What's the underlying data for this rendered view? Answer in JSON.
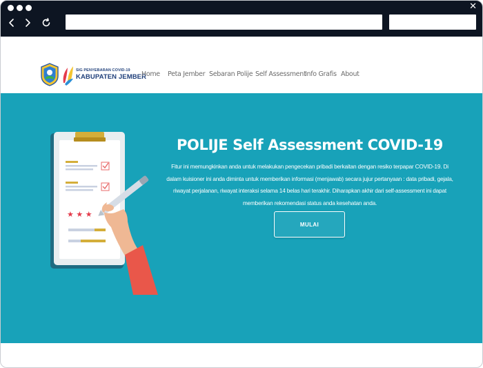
{
  "window": {
    "close_glyph": "✕"
  },
  "site": {
    "brand_line1": "SIG PENYEBARAN COVID-19",
    "brand_line2": "KABUPATEN JEMBER",
    "nav": [
      "Home",
      "Peta Jember",
      "Sebaran Polije",
      "Self Assessment",
      "Info Grafis",
      "About"
    ]
  },
  "hero": {
    "title": "POLIJE Self Assessment COVID-19",
    "description": "Fitur ini memungkinkan anda untuk melakukan pengecekan pribadi berkaitan dengan resiko terpapar COVID-19. Di dalam kuisioner ini anda diminta untuk memberikan informasi (menjawab) secara jujur pertanyaan : data pribadi, gejala, riwayat perjalanan, riwayat interaksi selama 14 belas hari terakhir. Diharapkan akhir dari self-assessment ini dapat memberikan rekomendasi status anda kesehatan anda.",
    "button_label": "MULAI"
  },
  "colors": {
    "chrome": "#0d1522",
    "hero_bg": "#18a2b9",
    "brand_text": "#1f3f7a",
    "nav_text": "#6b6b6b"
  },
  "icons": [
    "back-arrow-icon",
    "forward-arrow-icon",
    "reload-icon",
    "close-icon",
    "kabupaten-emblem-icon",
    "polije-logo-icon"
  ]
}
